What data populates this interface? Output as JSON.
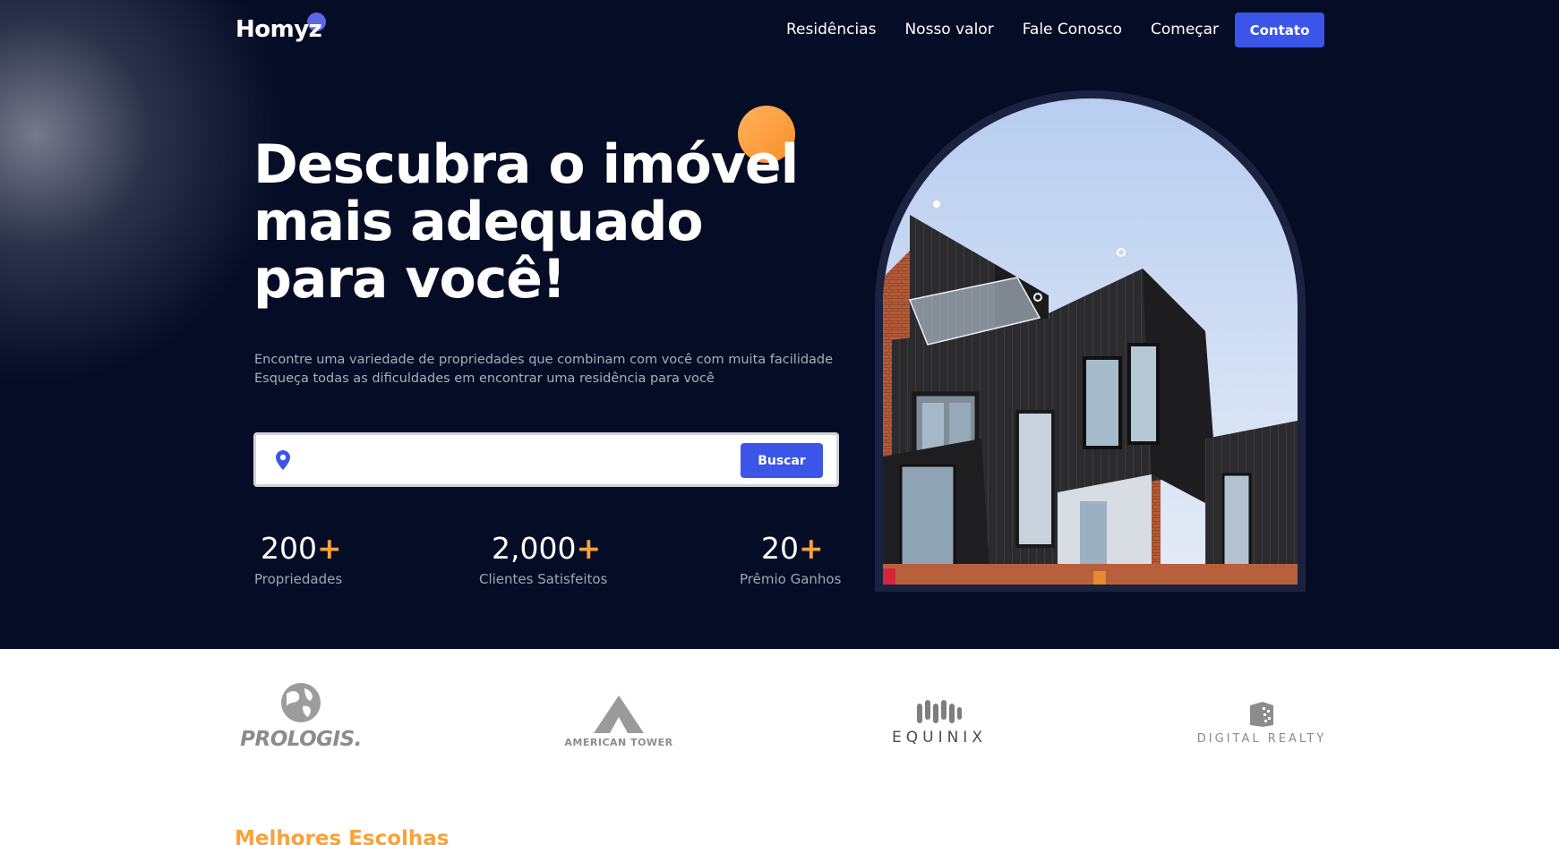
{
  "brand": {
    "name": "Homyz",
    "accent_dot_color": "#5a68e8"
  },
  "nav": {
    "items": [
      {
        "label": "Residências"
      },
      {
        "label": "Nosso valor"
      },
      {
        "label": "Fale Conosco"
      },
      {
        "label": "Começar"
      }
    ],
    "cta_label": "Contato"
  },
  "hero": {
    "headline_lines": [
      "Descubra o imóvel",
      "mais adequado",
      "para você!"
    ],
    "subtitle_lines": [
      "Encontre uma variedade de propriedades que combinam com você com muita facilidade",
      "Esqueça todas as dificuldades em encontrar uma residência para você"
    ],
    "search": {
      "value": "",
      "placeholder": "",
      "button_label": "Buscar",
      "icon": "location-pin-icon"
    },
    "stats": [
      {
        "number": "200",
        "suffix": "+",
        "label": "Propriedades"
      },
      {
        "number": "2,000",
        "suffix": "+",
        "label": "Clientes Satisfeitos"
      },
      {
        "number": "20",
        "suffix": "+",
        "label": "Prêmio Ganhos"
      }
    ]
  },
  "partners": [
    {
      "name": "PROLOGIS."
    },
    {
      "name": "AMERICAN TOWER"
    },
    {
      "name": "EQUINIX"
    },
    {
      "name": "DIGITAL REALTY"
    }
  ],
  "next_section": {
    "title": "Melhores Escolhas"
  },
  "colors": {
    "hero_background": "#050d26",
    "primary_blue": "#3a55e7",
    "accent_orange": "#f9a23a",
    "white": "#ffffff"
  }
}
